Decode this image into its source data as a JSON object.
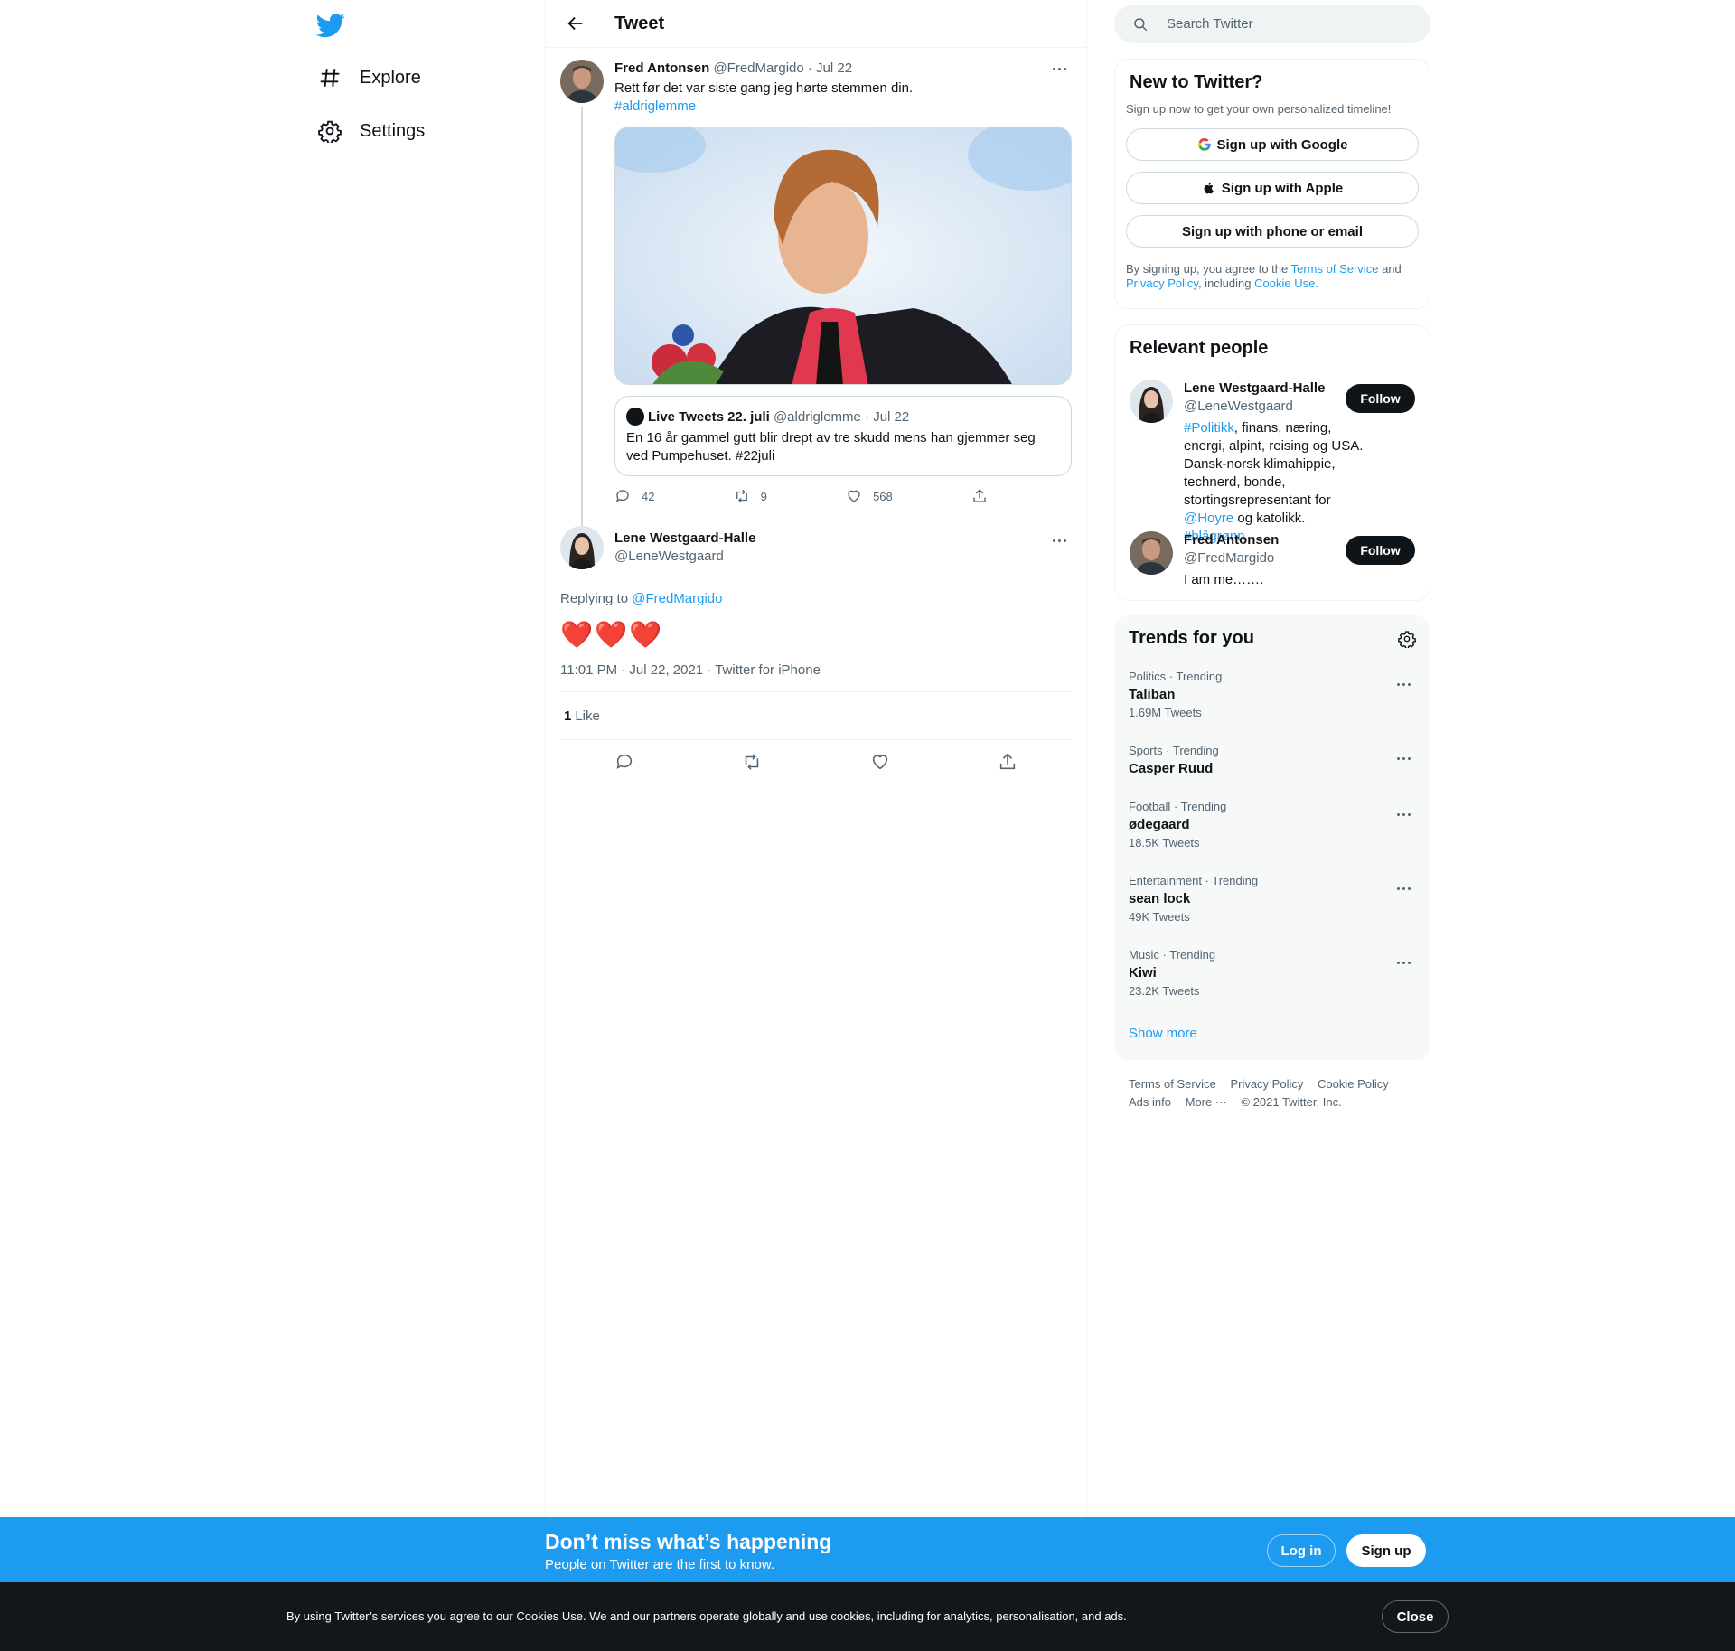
{
  "nav": {
    "items": [
      {
        "label": "Explore",
        "icon": "hashtag-icon"
      },
      {
        "label": "Settings",
        "icon": "gear-icon"
      }
    ]
  },
  "header": {
    "title": "Tweet"
  },
  "tweet": {
    "author_name": "Fred Antonsen",
    "author_handle": "@FredMargido",
    "date": "· Jul 22",
    "text": "Rett før det var siste gang jeg hørte stemmen din.",
    "hashtag": "#aldriglemme",
    "quote": {
      "name": "Live Tweets 22. juli",
      "handle": "@aldriglemme",
      "date": "· Jul 22",
      "text": "En 16 år gammel gutt blir drept av tre skudd mens han gjemmer seg ved Pumpehuset. #22juli"
    },
    "stats": {
      "replies": "42",
      "retweets": "9",
      "likes": "568"
    }
  },
  "reply": {
    "author_name": "Lene Westgaard-Halle",
    "author_handle": "@LeneWestgaard",
    "replying_prefix": "Replying to",
    "replying_to": "@FredMargido",
    "text": "❤️❤️❤️",
    "meta": "11:01 PM · Jul 22, 2021 · Twitter for iPhone",
    "like_count": "1",
    "like_label": "Like"
  },
  "search": {
    "placeholder": "Search Twitter"
  },
  "new_to_twitter": {
    "title": "New to Twitter?",
    "subtitle": "Sign up now to get your own personalized timeline!",
    "google": "Sign up with Google",
    "apple": "Sign up with Apple",
    "phone": "Sign up with phone or email",
    "terms_1": "By signing up, you agree to the",
    "terms_link": "Terms of Service",
    "terms_2": "and",
    "privacy_link": "Privacy Policy",
    "terms_3": ", including",
    "cookie_link": "Cookie Use."
  },
  "relevant": {
    "title": "Relevant people",
    "people": [
      {
        "name": "Lene Westgaard-Halle",
        "handle": "@LeneWestgaard",
        "follow": "Follow",
        "bio_tag1": "#Politikk",
        "bio_1": ", finans, næring, energi, alpint, reising og USA. Dansk-norsk klimahippie, technerd, bonde, stortingsrepresentant for ",
        "bio_mention": "@Hoyre",
        "bio_2": " og katolikk. ",
        "bio_tag2": "#blågrønn"
      },
      {
        "name": "Fred Antonsen",
        "handle": "@FredMargido",
        "follow": "Follow",
        "bio": "I am me……."
      }
    ]
  },
  "trends": {
    "title": "Trends for you",
    "items": [
      {
        "category": "Politics · Trending",
        "name": "Taliban",
        "count": "1.69M Tweets"
      },
      {
        "category": "Sports · Trending",
        "name": "Casper Ruud",
        "count": ""
      },
      {
        "category": "Football · Trending",
        "name": "ødegaard",
        "count": "18.5K Tweets"
      },
      {
        "category": "Entertainment · Trending",
        "name": "sean lock",
        "count": "49K Tweets"
      },
      {
        "category": "Music · Trending",
        "name": "Kiwi",
        "count": "23.2K Tweets"
      }
    ],
    "show_more": "Show more"
  },
  "footer": {
    "links": [
      "Terms of Service",
      "Privacy Policy",
      "Cookie Policy",
      "Ads info",
      "More ···"
    ],
    "copyright": "© 2021 Twitter, Inc."
  },
  "bottom_bar": {
    "title": "Don’t miss what’s happening",
    "subtitle": "People on Twitter are the first to know.",
    "login": "Log in",
    "signup": "Sign up"
  },
  "cookie_banner": {
    "text": "By using Twitter’s services you agree to our Cookies Use. We and our partners operate globally and use cookies, including for analytics, personalisation, and ads.",
    "close": "Close"
  },
  "colors": {
    "accent": "#1d9bf0",
    "text": "#0f1419",
    "muted": "#536471",
    "heart": "#e0245e"
  }
}
